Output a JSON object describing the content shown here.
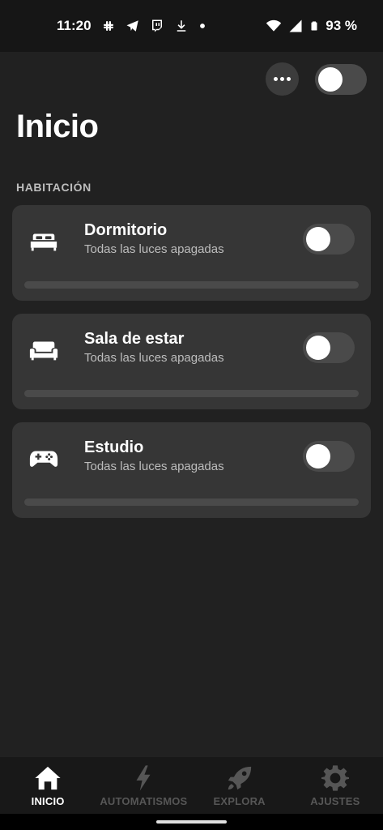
{
  "status_bar": {
    "time": "11:20",
    "battery": "93 %",
    "notification_icons": [
      "slack-icon",
      "telegram-icon",
      "twitch-icon",
      "download-icon",
      "dot-icon"
    ],
    "system_icons": [
      "wifi-icon",
      "signal-icon",
      "battery-icon"
    ]
  },
  "header": {
    "more_icon": "more-horizontal-icon",
    "master_toggle_on": false
  },
  "page": {
    "title": "Inicio",
    "section_label": "HABITACIÓN"
  },
  "rooms": [
    {
      "name": "Dormitorio",
      "status": "Todas las luces apagadas",
      "icon": "bed-icon",
      "on": false
    },
    {
      "name": "Sala de estar",
      "status": "Todas las luces apagadas",
      "icon": "sofa-icon",
      "on": false
    },
    {
      "name": "Estudio",
      "status": "Todas las luces apagadas",
      "icon": "gamepad-icon",
      "on": false
    }
  ],
  "bottom_nav": [
    {
      "label": "INICIO",
      "icon": "home-icon",
      "active": true
    },
    {
      "label": "AUTOMATISMOS",
      "icon": "bolt-icon",
      "active": false
    },
    {
      "label": "EXPLORA",
      "icon": "rocket-icon",
      "active": false
    },
    {
      "label": "AJUSTES",
      "icon": "gear-icon",
      "active": false
    }
  ],
  "colors": {
    "background": "#212121",
    "card": "#363636",
    "toggle_off": "#4a4a4a",
    "nav_inactive": "#565656"
  }
}
